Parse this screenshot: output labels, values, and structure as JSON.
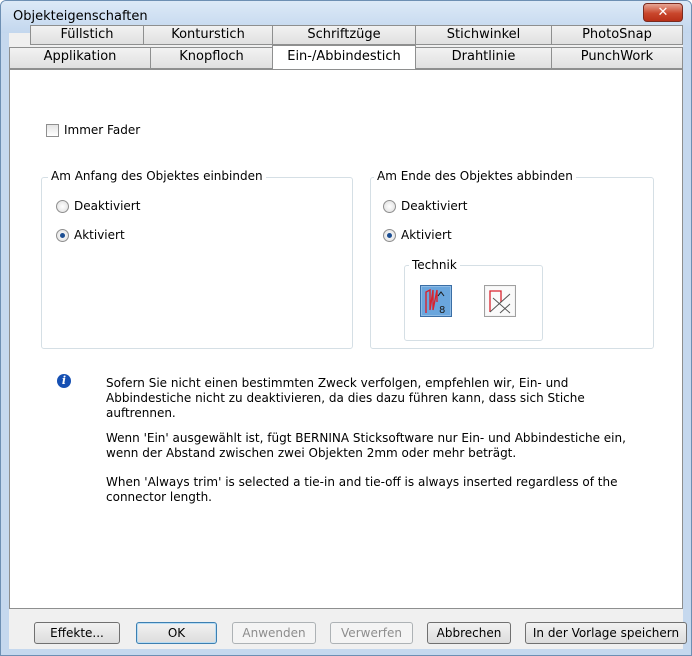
{
  "window": {
    "title": "Objekteigenschaften",
    "close_glyph": "✕"
  },
  "tabs_row1": [
    "Füllstich",
    "Konturstich",
    "Schriftzüge",
    "Stichwinkel",
    "PhotoSnap"
  ],
  "tabs_row2": [
    "Applikation",
    "Knopfloch",
    "Ein-/Abbindestich",
    "Drahtlinie",
    "PunchWork"
  ],
  "active_tab": "Ein-/Abbindestich",
  "checkbox": {
    "label": "Immer Fader",
    "checked": false
  },
  "group_start": {
    "legend": "Am Anfang des Objektes einbinden",
    "options": [
      "Deaktiviert",
      "Aktiviert"
    ],
    "selected": "Aktiviert"
  },
  "group_end": {
    "legend": "Am Ende des Objektes abbinden",
    "options": [
      "Deaktiviert",
      "Aktiviert"
    ],
    "selected": "Aktiviert",
    "technik": {
      "legend": "Technik",
      "icons": [
        "tie-off-stitch-icon",
        "tie-off-cross-icon"
      ],
      "selected": 0
    }
  },
  "info": {
    "icon": "info-icon",
    "p1_lines": [
      "Sofern Sie nicht einen bestimmten Zweck verfolgen, empfehlen wir, Ein- und",
      "Abbindestiche nicht zu deaktivieren, da dies dazu führen kann, dass sich Stiche",
      "auftrennen."
    ],
    "p2_lines": [
      "Wenn 'Ein' ausgewählt ist, fügt BERNINA Sticksoftware nur Ein- und Abbindestiche ein,",
      "wenn der Abstand zwischen zwei Objekten 2mm oder mehr beträgt."
    ],
    "p3_lines": [
      "When 'Always trim' is selected a tie-in and tie-off is always inserted regardless of the",
      "connector length."
    ]
  },
  "buttons": {
    "effekte": "Effekte...",
    "ok": "OK",
    "anwenden": "Anwenden",
    "verwerfen": "Verwerfen",
    "abbrechen": "Abbrechen",
    "speichern": "In der Vorlage speichern"
  },
  "colors": {
    "accent": "#1c4e92",
    "icon_red": "#d9232e",
    "icon_blue_bg": "#5b9bd5"
  }
}
